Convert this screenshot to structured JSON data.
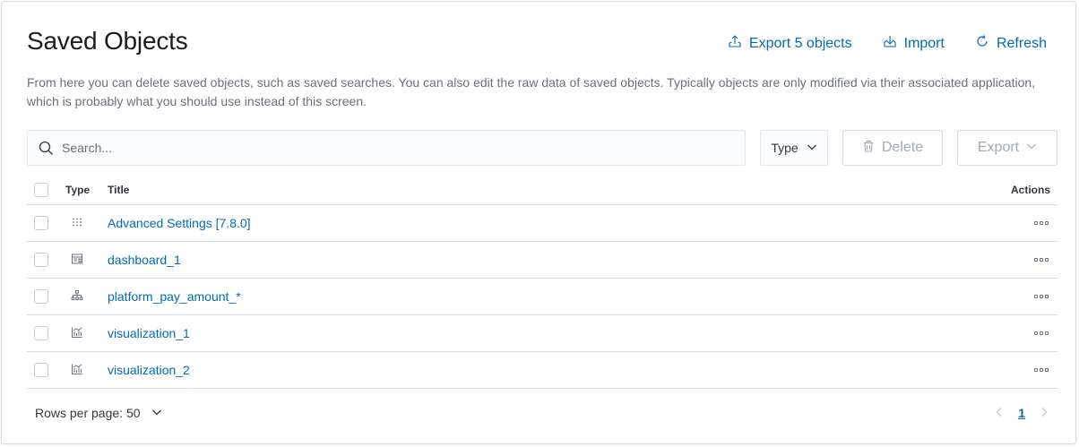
{
  "header": {
    "title": "Saved Objects",
    "actions": {
      "export_all": "Export 5 objects",
      "import": "Import",
      "refresh": "Refresh"
    }
  },
  "description": "From here you can delete saved objects, such as saved searches. You can also edit the raw data of saved objects. Typically objects are only modified via their associated application, which is probably what you should use instead of this screen.",
  "toolbar": {
    "search_placeholder": "Search...",
    "type_filter": "Type",
    "delete_label": "Delete",
    "export_label": "Export"
  },
  "table": {
    "columns": {
      "type": "Type",
      "title": "Title",
      "actions": "Actions"
    },
    "rows": [
      {
        "type_icon": "advanced-settings-icon",
        "title": "Advanced Settings [7.8.0]"
      },
      {
        "type_icon": "dashboard-icon",
        "title": "dashboard_1"
      },
      {
        "type_icon": "index-pattern-icon",
        "title": "platform_pay_amount_*"
      },
      {
        "type_icon": "visualization-icon",
        "title": "visualization_1"
      },
      {
        "type_icon": "visualization-icon",
        "title": "visualization_2"
      }
    ]
  },
  "footer": {
    "rows_per_page": "Rows per page: 50",
    "current_page": "1"
  },
  "colors": {
    "link": "#006bb4",
    "text": "#343741",
    "muted": "#69707d",
    "border": "#d3dae6",
    "disabled": "#a2abba"
  }
}
